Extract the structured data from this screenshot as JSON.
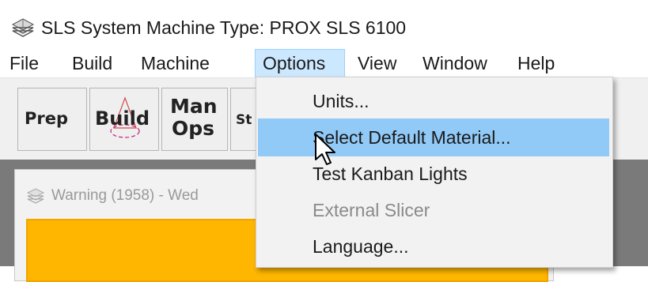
{
  "window": {
    "title": "SLS System Machine Type: PROX SLS 6100",
    "icon": "stacked-layers-app-icon"
  },
  "menubar": {
    "items": [
      "File",
      "Build",
      "Machine",
      "Options",
      "View",
      "Window",
      "Help"
    ],
    "active": "Options"
  },
  "toolbar": {
    "prep_label": "Prep",
    "build_label": "Build",
    "manops_line1": "Man",
    "manops_line2": "Ops",
    "partial_label": "St"
  },
  "options_menu": {
    "items": [
      {
        "label": "Units...",
        "enabled": true
      },
      {
        "label": "Select Default Material...",
        "enabled": true,
        "highlighted": true
      },
      {
        "label": "Test Kanban Lights",
        "enabled": true
      },
      {
        "label": "External Slicer",
        "enabled": false
      },
      {
        "label": "Language...",
        "enabled": true
      }
    ]
  },
  "warning_window": {
    "title": "Warning (1958) - Wed",
    "body_color": "#ffb600"
  },
  "colors": {
    "highlight": "#91c9f7",
    "active_menu": "#cce8ff",
    "workspace": "#7a7a7a"
  }
}
